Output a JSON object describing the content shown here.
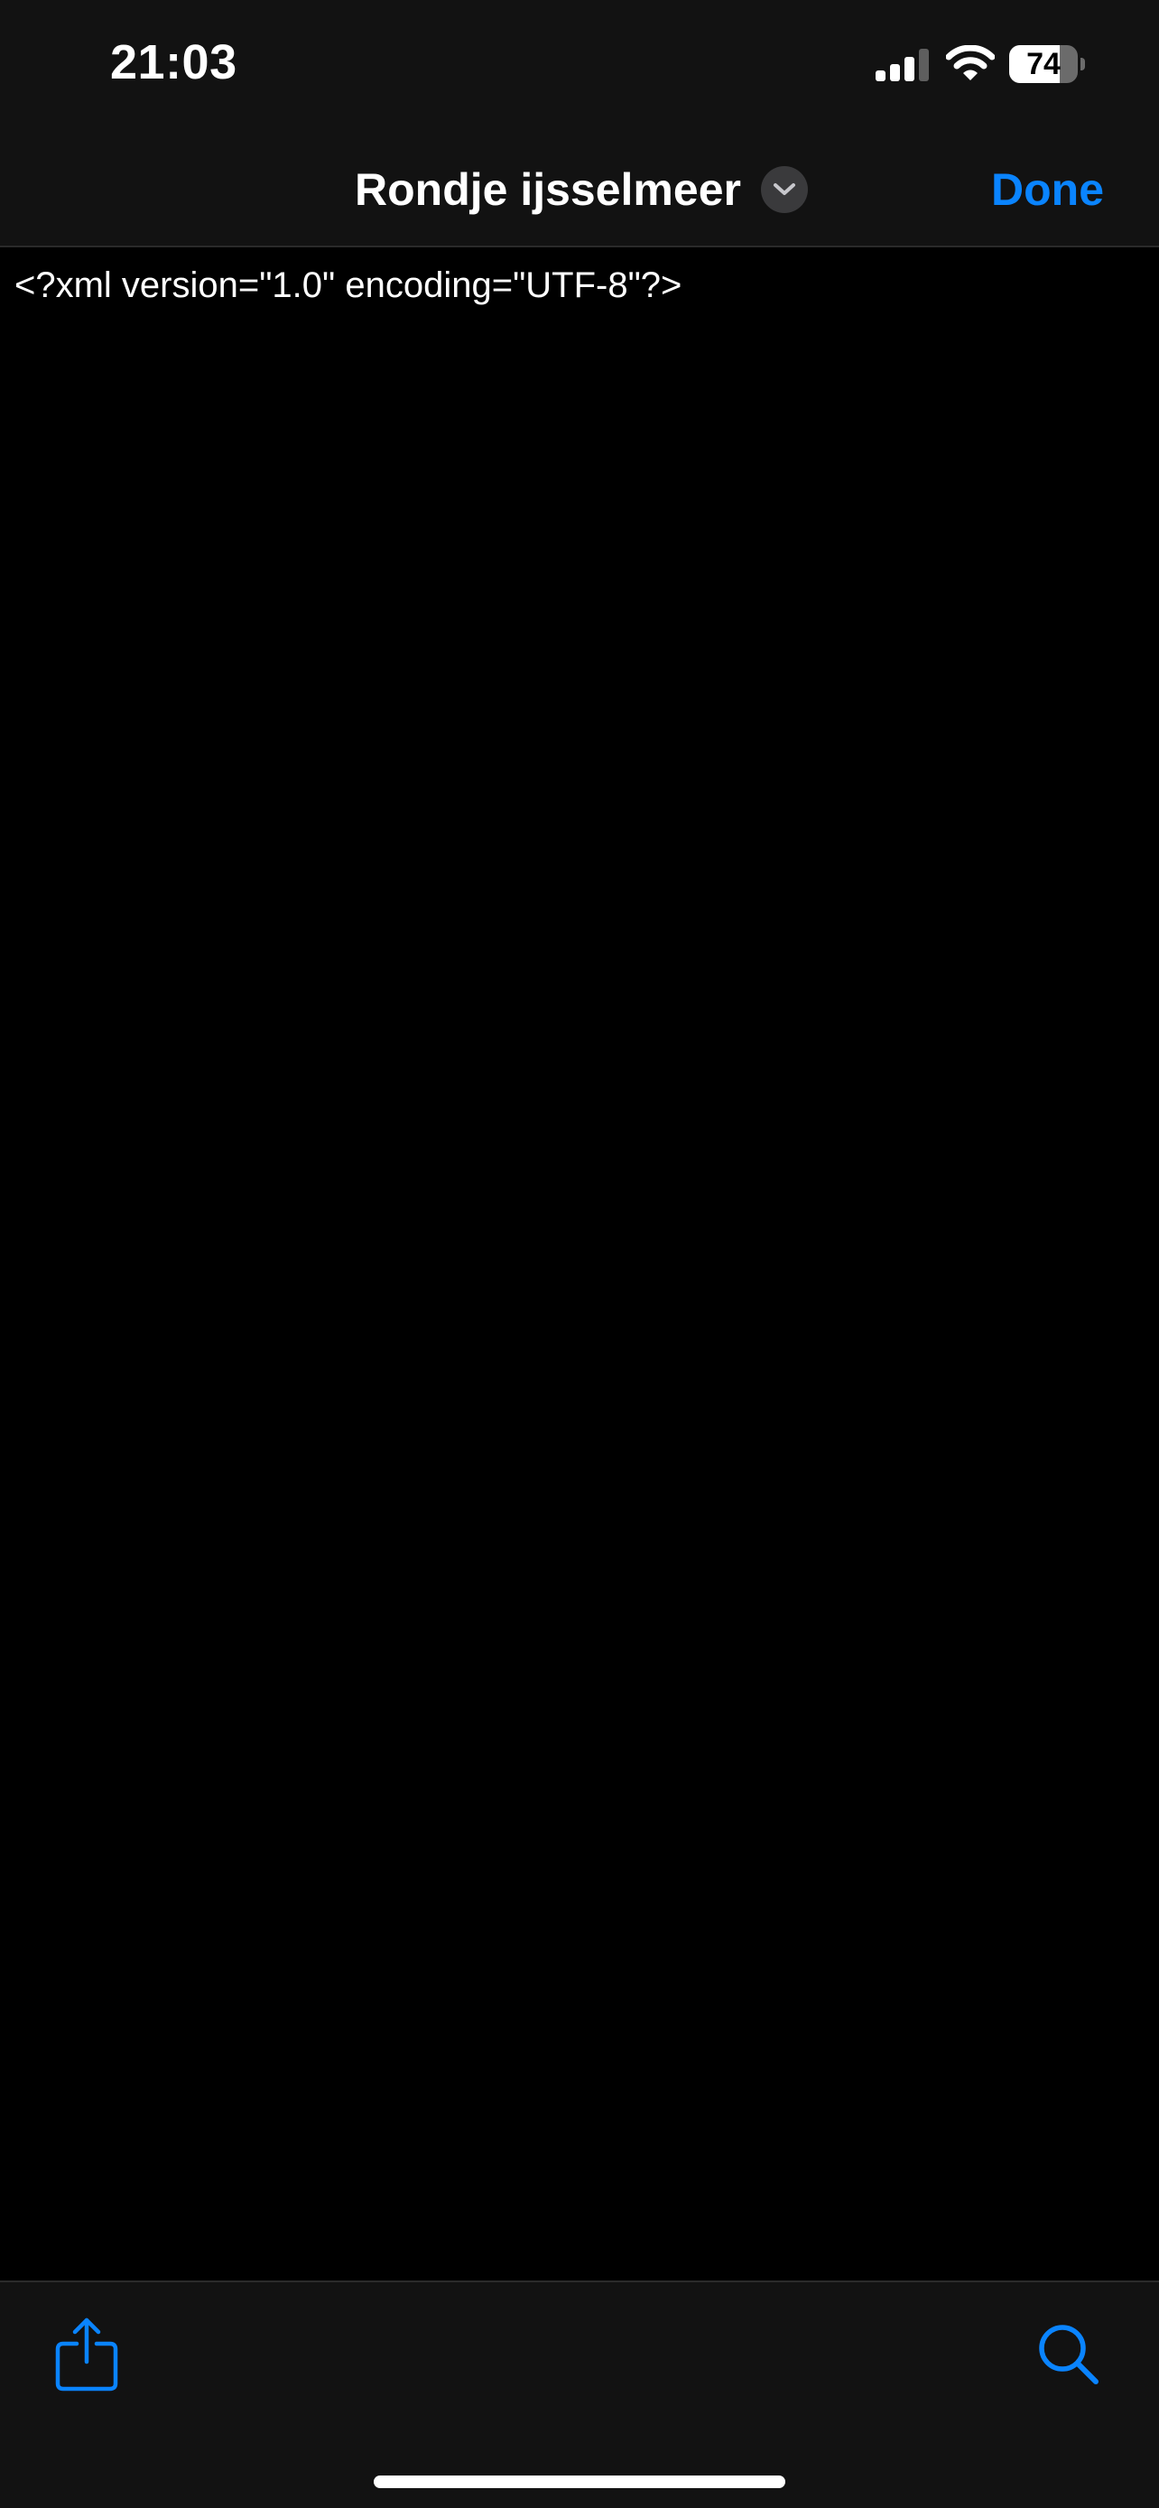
{
  "status_bar": {
    "time": "21:03",
    "battery_level": 74,
    "battery_label": "74"
  },
  "nav": {
    "title": "Rondje ijsselmeer",
    "done_label": "Done"
  },
  "editor": {
    "lines": [
      "<?xml version=\"1.0\" encoding=\"UTF-8\"?>"
    ]
  },
  "icons": {
    "title_menu": "chevron-down-icon",
    "share": "share-icon",
    "search": "search-icon"
  },
  "colors": {
    "accent": "#0a84ff",
    "chrome_background": "#121212",
    "editor_background": "#000000",
    "text": "#ffffff"
  }
}
